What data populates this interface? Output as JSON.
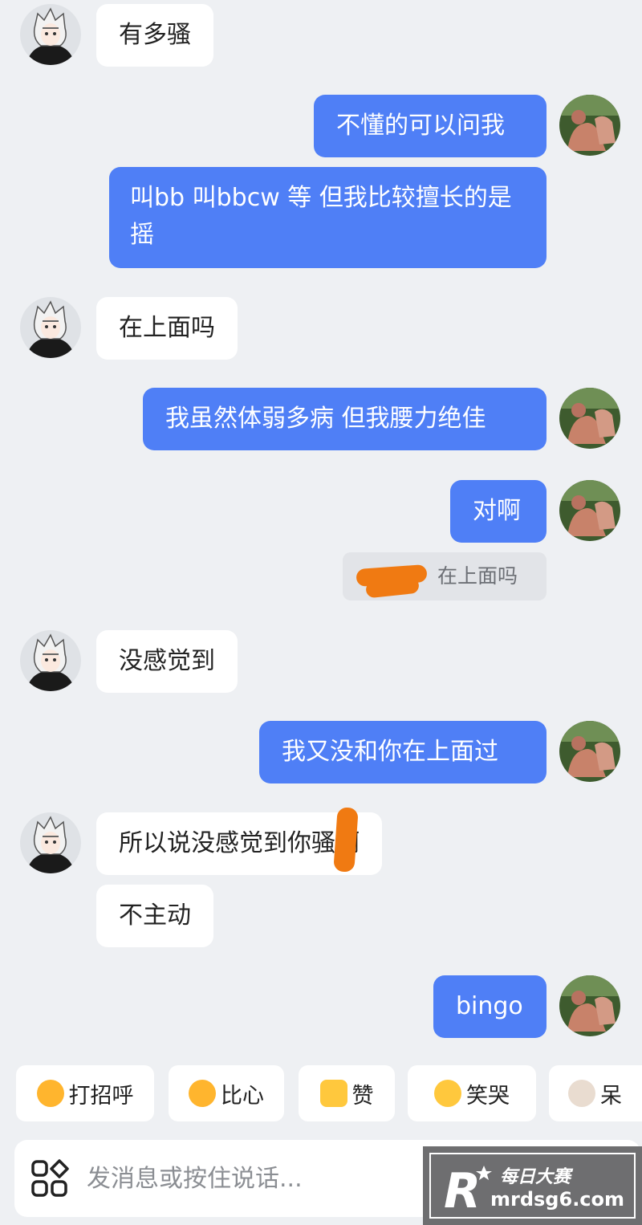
{
  "messages": [
    {
      "side": "in",
      "text": "有多骚"
    },
    {
      "side": "out",
      "text": "不懂的可以问我"
    },
    {
      "side": "out",
      "text": "叫bb 叫bbcw 等 但我比较擅长的是 摇"
    },
    {
      "side": "in",
      "text": "在上面吗"
    },
    {
      "side": "out",
      "text": "我虽然体弱多病 但我腰力绝佳"
    },
    {
      "side": "out",
      "text": "对啊"
    },
    {
      "side": "in",
      "text": "没感觉到"
    },
    {
      "side": "out",
      "text": "我又没和你在上面过"
    },
    {
      "side": "in",
      "text": "所以说没感觉到你骚啊"
    },
    {
      "side": "in",
      "text": "不主动"
    },
    {
      "side": "out",
      "text": "bingo"
    }
  ],
  "quote": {
    "text": "在上面吗"
  },
  "quick_replies": [
    {
      "label": "打招呼",
      "icon": "waving-emoji-icon"
    },
    {
      "label": "比心",
      "icon": "heart-hands-emoji-icon"
    },
    {
      "label": "赞",
      "icon": "thumbs-up-icon"
    },
    {
      "label": "笑哭",
      "icon": "tears-of-joy-emoji-icon"
    },
    {
      "label": "呆",
      "icon": "dazed-cat-emoji-icon"
    }
  ],
  "input": {
    "placeholder": "发消息或按住说话..."
  },
  "watermark": {
    "line1": "每日大赛",
    "line2": "mrdsg6.com",
    "logo_letter": "R"
  },
  "colors": {
    "background": "#eef0f3",
    "incoming_bubble": "#ffffff",
    "outgoing_bubble": "#4f7ff6",
    "redaction": "#f07a12"
  }
}
